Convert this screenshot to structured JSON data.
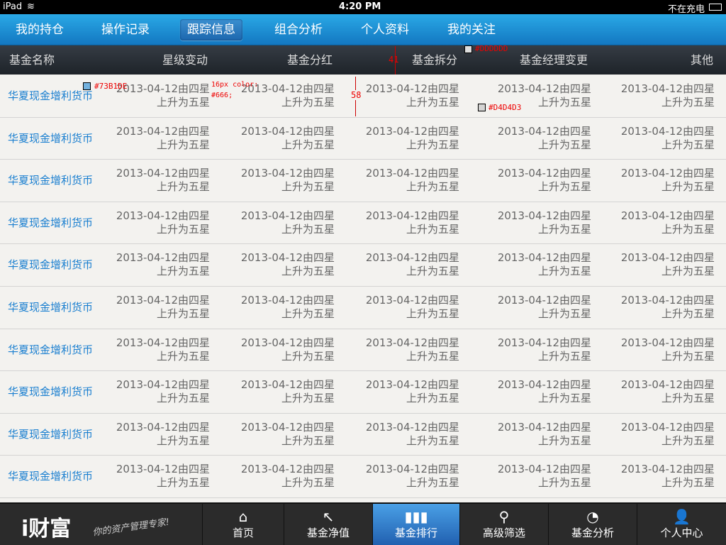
{
  "status": {
    "device": "iPad",
    "time": "4:20 PM",
    "charging": "不在充电"
  },
  "nav": {
    "tabs": [
      "我的持仓",
      "操作记录",
      "跟踪信息",
      "组合分析",
      "个人资料",
      "我的关注"
    ],
    "active": 2
  },
  "table": {
    "headers": [
      "基金名称",
      "星级变动",
      "基金分红",
      "基金拆分",
      "基金经理变更",
      "其他"
    ],
    "rows": [
      {
        "name": "华夏现金增利货币",
        "line1": "2013-04-12由四星",
        "line2": "上升为五星"
      },
      {
        "name": "华夏现金增利货币",
        "line1": "2013-04-12由四星",
        "line2": "上升为五星"
      },
      {
        "name": "华夏现金增利货币",
        "line1": "2013-04-12由四星",
        "line2": "上升为五星"
      },
      {
        "name": "华夏现金增利货币",
        "line1": "2013-04-12由四星",
        "line2": "上升为五星"
      },
      {
        "name": "华夏现金增利货币",
        "line1": "2013-04-12由四星",
        "line2": "上升为五星"
      },
      {
        "name": "华夏现金增利货币",
        "line1": "2013-04-12由四星",
        "line2": "上升为五星"
      },
      {
        "name": "华夏现金增利货币",
        "line1": "2013-04-12由四星",
        "line2": "上升为五星"
      },
      {
        "name": "华夏现金增利货币",
        "line1": "2013-04-12由四星",
        "line2": "上升为五星"
      },
      {
        "name": "华夏现金增利货币",
        "line1": "2013-04-12由四星",
        "line2": "上升为五星"
      },
      {
        "name": "华夏现金增利货币",
        "line1": "2013-04-12由四星",
        "line2": "上升为五星"
      }
    ]
  },
  "annotations": {
    "header_color": "#DDDDDD",
    "name_color": "#73B1DE",
    "font_note1": "16px color:",
    "font_note2": "#666;",
    "header_height": "41",
    "row_height": "58",
    "border_color": "#D4D4D3"
  },
  "bottom": {
    "logo": "i财富",
    "slogan": "你的资产管理专家!",
    "tabs": [
      {
        "label": "首页",
        "icon": "home-icon"
      },
      {
        "label": "基金净值",
        "icon": "trend-icon"
      },
      {
        "label": "基金排行",
        "icon": "bar-chart-icon"
      },
      {
        "label": "高级筛选",
        "icon": "search-icon"
      },
      {
        "label": "基金分析",
        "icon": "pie-chart-icon"
      },
      {
        "label": "个人中心",
        "icon": "user-icon"
      }
    ],
    "active": 2
  }
}
